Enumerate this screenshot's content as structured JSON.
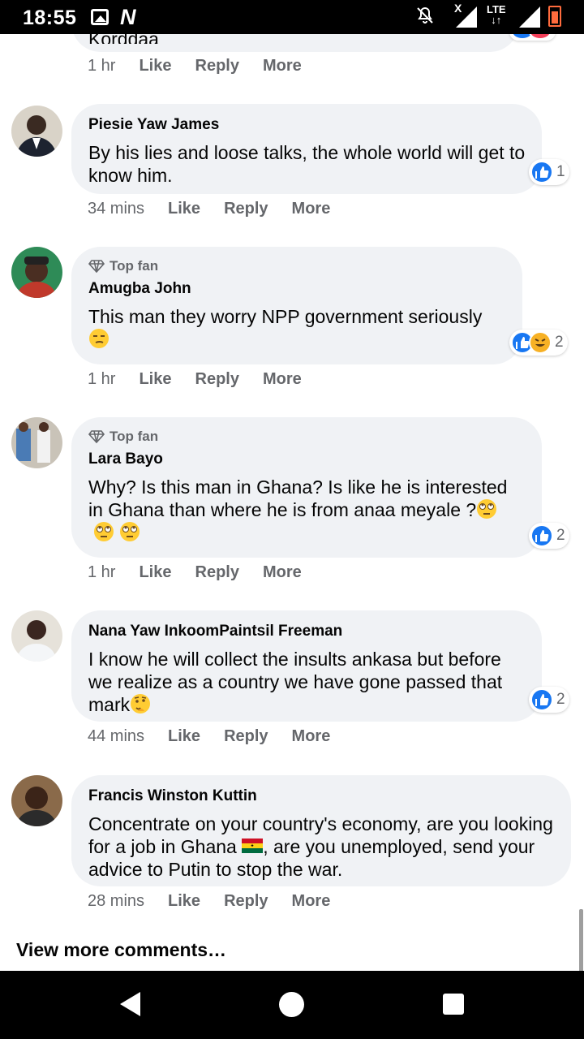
{
  "status_bar": {
    "time": "18:55",
    "network": "LTE",
    "x_mark": "X"
  },
  "actions": {
    "like": "Like",
    "reply": "Reply",
    "more": "More"
  },
  "top_fan_label": "Top fan",
  "comments": [
    {
      "author": "",
      "text": "Korddaa",
      "time": "1 hr",
      "reactions": []
    },
    {
      "author": "Piesie Yaw James",
      "top_fan": false,
      "text": "By his lies and loose talks, the whole world will get to know him.",
      "time": "34 mins",
      "reactions": [
        "like"
      ],
      "reaction_count": "1"
    },
    {
      "author": "Amugba John",
      "top_fan": true,
      "text": "This man they worry NPP government seriously",
      "emoji": "smirk-face",
      "time": "1 hr",
      "reactions": [
        "like",
        "haha"
      ],
      "reaction_count": "2"
    },
    {
      "author": "Lara Bayo",
      "top_fan": true,
      "text": "Why? Is this man in Ghana? Is like he is interested in Ghana than where he is from anaa meyale ?",
      "emoji": "rolling-eyes x3",
      "time": "1 hr",
      "reactions": [
        "like"
      ],
      "reaction_count": "2"
    },
    {
      "author": "Nana Yaw InkoomPaintsil Freeman",
      "top_fan": false,
      "text": "I know he will collect the insults ankasa but before we realize as a country we have gone passed that mark",
      "emoji": "thinking-face",
      "time": "44 mins",
      "reactions": [
        "like"
      ],
      "reaction_count": "2"
    },
    {
      "author": "Francis Winston Kuttin",
      "top_fan": false,
      "text_part1": "Concentrate on your country's economy, are you looking for a job in Ghana ",
      "text_part2": ", are you unemployed, send your advice to Putin to stop the war.",
      "emoji": "ghana-flag",
      "time": "28 mins",
      "reactions": []
    }
  ],
  "view_more": "View more comments…",
  "colors": {
    "like_blue": "#1877f2",
    "bubble_bg": "#f0f2f5",
    "meta_gray": "#65676b"
  }
}
